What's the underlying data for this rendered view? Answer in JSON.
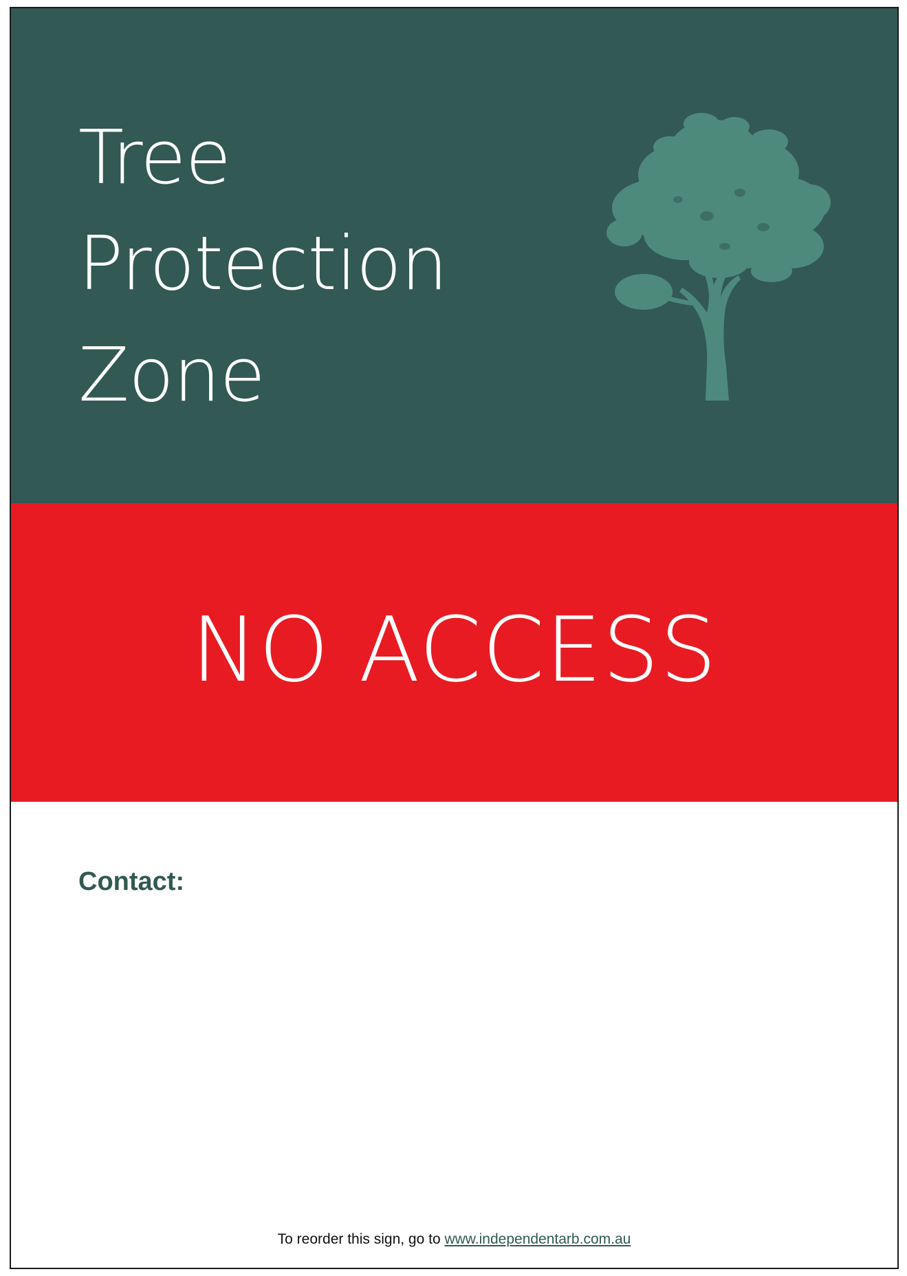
{
  "sign": {
    "title_lines": [
      "Tree",
      "Protection",
      "Zone"
    ],
    "headline": "NO ACCESS",
    "contact_label": "Contact:",
    "footer_text": "To reorder this sign, go to ",
    "footer_link": "www.independentarb.com.au"
  },
  "icons": {
    "tree": "tree-silhouette-icon"
  },
  "colors": {
    "top_panel": "#325953",
    "red_panel": "#e81b23",
    "tree": "#4e8a7c",
    "title_text": "#ffffff",
    "contact_text": "#325953"
  }
}
